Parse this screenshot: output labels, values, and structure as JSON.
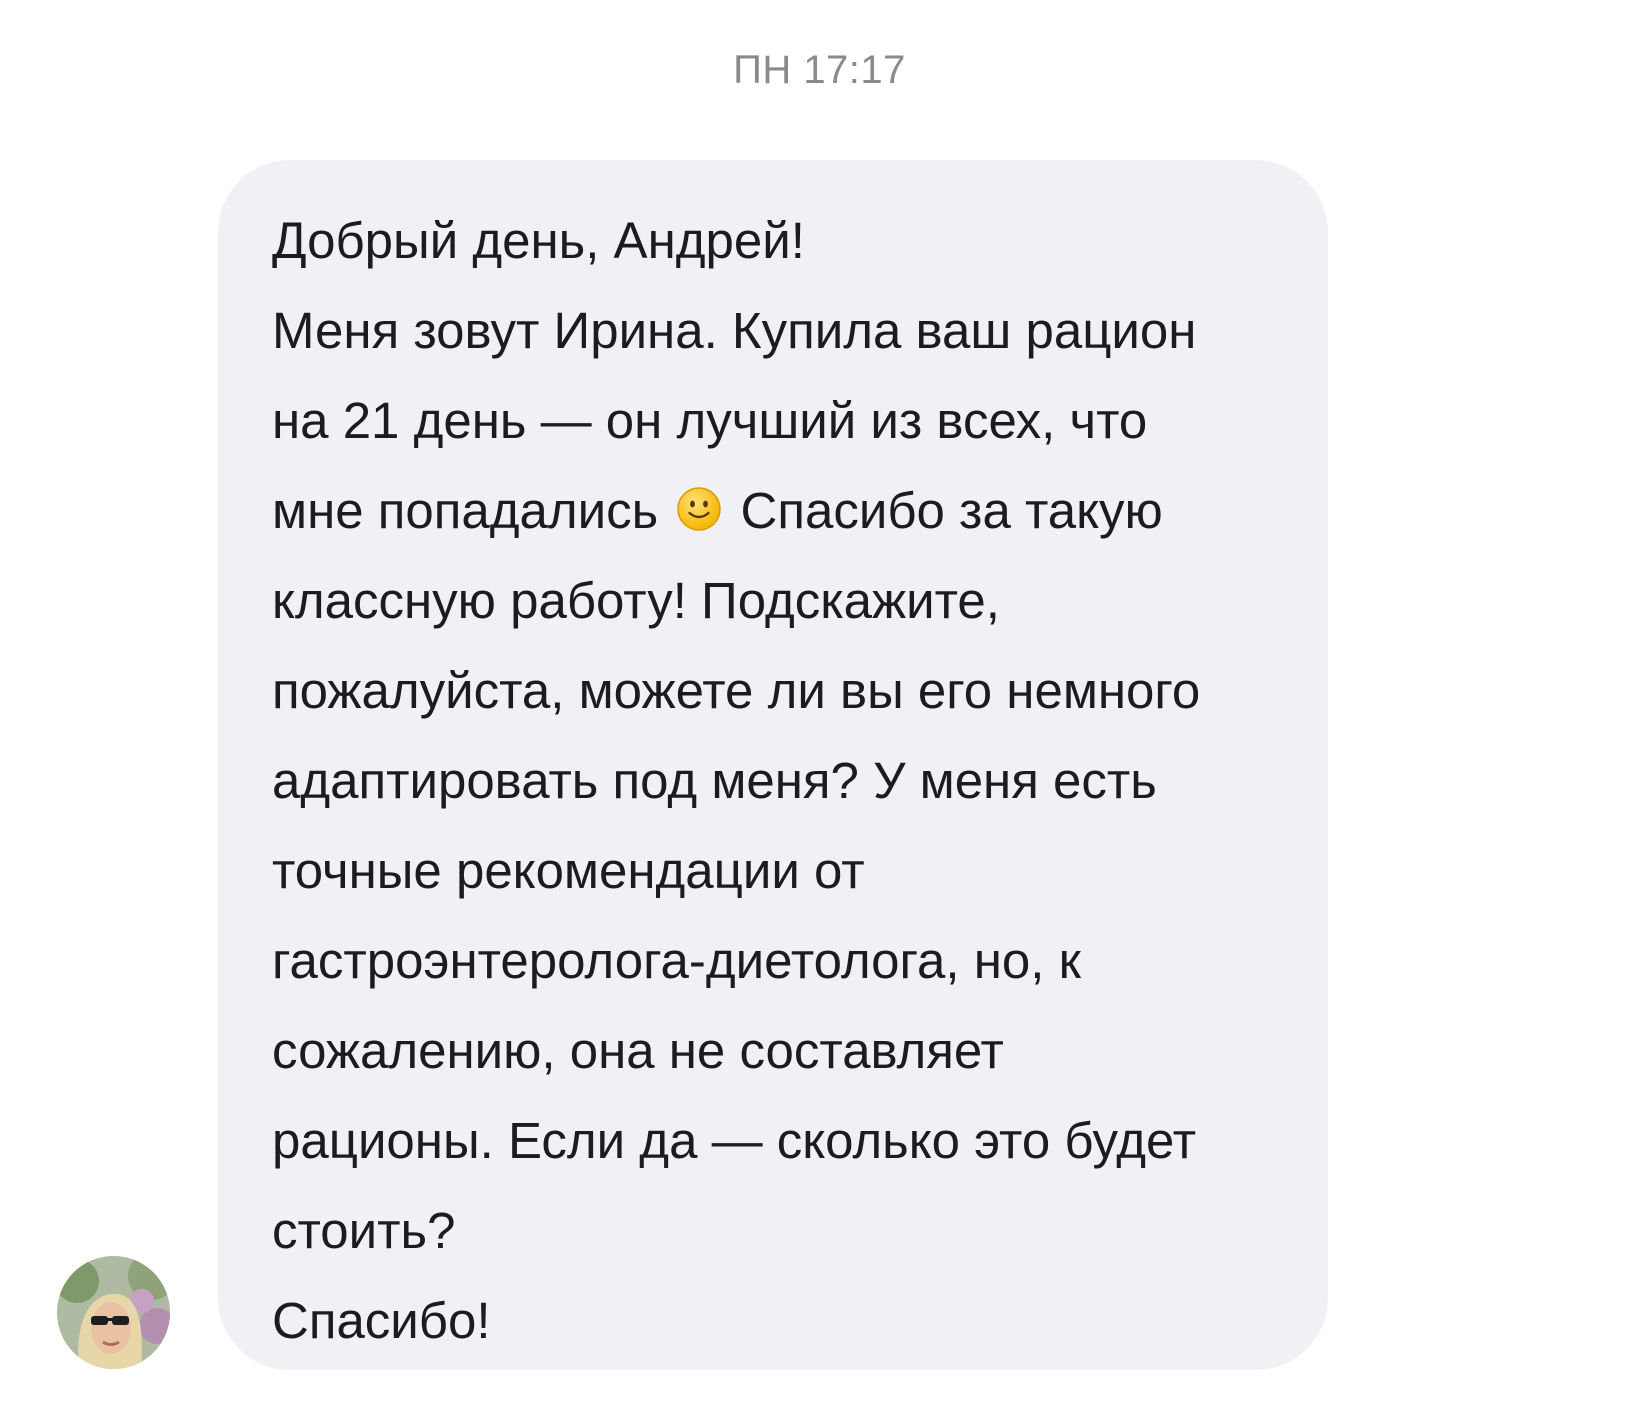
{
  "header": {
    "timestamp": "ПН 17:17"
  },
  "message": {
    "sender_avatar_icon": "user-avatar-photo",
    "bubble_color": "#f1f1f5",
    "lines": [
      "Добрый день, Андрей!",
      "Меня зовут Ирина. Купила ваш рацион",
      "на 21 день — он лучший из всех, что",
      "мне попадались",
      "Спасибо за такую",
      "классную работу! Подскажите,",
      "пожалуйста, можете ли вы его немного",
      "адаптировать под меня? У меня есть",
      "точные рекомендации от",
      "гастроэнтеролога-диетолога, но, к",
      "сожалению, она не составляет",
      "рационы. Если да — сколько это будет",
      "стоить?",
      "Спасибо!"
    ],
    "emoji": "slightly-smiling-face-icon"
  }
}
